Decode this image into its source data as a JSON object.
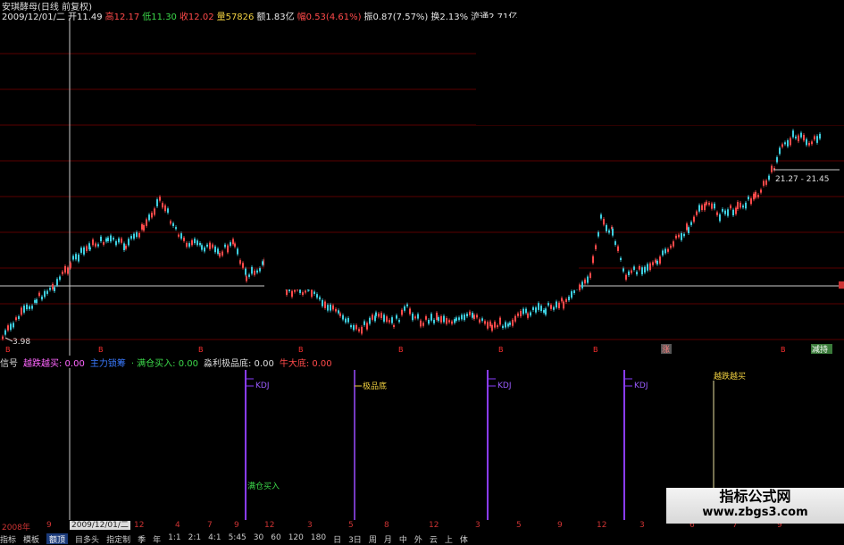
{
  "header": {
    "title": "安琪酵母(日线 前复权)",
    "quote": [
      {
        "text": "2009/12/01/二",
        "cls": "w"
      },
      {
        "text": "开11.49",
        "cls": "w"
      },
      {
        "text": "高12.17",
        "cls": "r"
      },
      {
        "text": "低11.30",
        "cls": "g"
      },
      {
        "text": "收12.02",
        "cls": "r"
      },
      {
        "text": "量57826",
        "cls": "y"
      },
      {
        "text": "额1.83亿",
        "cls": "w"
      },
      {
        "text": "幅0.53(4.61%)",
        "cls": "r"
      },
      {
        "text": "振0.87(7.57%)",
        "cls": "w"
      },
      {
        "text": "换2.13%",
        "cls": "w"
      },
      {
        "text": "流通2.71亿",
        "cls": "w"
      }
    ]
  },
  "main_chart": {
    "low_label": "3.98",
    "range_label": "21.27 - 21.45",
    "markers": [
      "B",
      "B",
      "B",
      "B",
      "B",
      "B",
      "B",
      "B"
    ],
    "zhang_label": "涨",
    "jianchi_label": "减持"
  },
  "signal_bar": {
    "items": [
      {
        "label": "信号",
        "color": "#dddddd"
      },
      {
        "label": "越跌越买: 0.00",
        "color": "#ff66ff"
      },
      {
        "label": "主力锁筹",
        "color": "#3a7aff"
      },
      {
        "label": "· 满仓买入: 0.00",
        "color": "#3cd84a"
      },
      {
        "label": "淼利极品底: 0.00",
        "color": "#dddddd"
      },
      {
        "label": "牛大底: 0.00",
        "color": "#ff4a4a"
      }
    ]
  },
  "sub_chart": {
    "labels": [
      {
        "text": "KDJ",
        "color": "#9b5cff"
      },
      {
        "text": "极品底",
        "color": "#f0d040"
      },
      {
        "text": "KDJ",
        "color": "#9b5cff"
      },
      {
        "text": "KDJ",
        "color": "#9b5cff"
      },
      {
        "text": "越跌越买",
        "color": "#f0d040"
      },
      {
        "text": "满仓买入",
        "color": "#3cd84a"
      }
    ]
  },
  "bottom_axis": {
    "year_label": "2008年",
    "date_box": "2009/12/01/二",
    "ticks": [
      "9",
      "12",
      "4",
      "7",
      "9",
      "12",
      "3",
      "5",
      "8",
      "12",
      "3",
      "5",
      "9",
      "12",
      "3",
      "6",
      "7",
      "9"
    ]
  },
  "tabs": [
    {
      "label": "指标"
    },
    {
      "label": "模板"
    },
    {
      "label": "额顶",
      "active": true
    },
    {
      "label": "目多头"
    },
    {
      "label": "指定制"
    },
    {
      "label": "季"
    },
    {
      "label": "年"
    },
    {
      "label": "1:1"
    },
    {
      "label": "2:1"
    },
    {
      "label": "4:1"
    },
    {
      "label": "5:45"
    },
    {
      "label": "30"
    },
    {
      "label": "60"
    },
    {
      "label": "120"
    },
    {
      "label": "180"
    },
    {
      "label": "日"
    },
    {
      "label": "3日"
    },
    {
      "label": "周"
    },
    {
      "label": "月"
    },
    {
      "label": "中"
    },
    {
      "label": "外"
    },
    {
      "label": "云"
    },
    {
      "label": "上"
    },
    {
      "label": "体"
    }
  ],
  "watermark": {
    "title": "指标公式网",
    "url": "www.zbgs3.com"
  },
  "colors": {
    "up": "#ff4a4a",
    "down": "#3ecfe0",
    "grid": "#5a0000",
    "accent_purple": "#8a3cff"
  }
}
